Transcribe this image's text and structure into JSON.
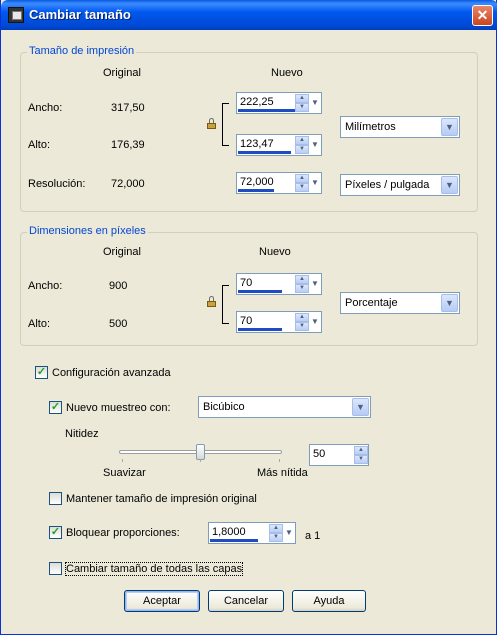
{
  "window": {
    "title": "Cambiar tamaño"
  },
  "print_size": {
    "title": "Tamaño de impresión",
    "col_original": "Original",
    "col_new": "Nuevo",
    "width_label": "Ancho:",
    "height_label": "Alto:",
    "resolution_label": "Resolución:",
    "width_original": "317,50",
    "height_original": "176,39",
    "resolution_original": "72,000",
    "width_new": "222,25",
    "height_new": "123,47",
    "resolution_new": "72,000",
    "unit": "Milímetros",
    "resolution_unit": "Píxeles / pulgada"
  },
  "pixel_dims": {
    "title": "Dimensiones en píxeles",
    "col_original": "Original",
    "col_new": "Nuevo",
    "width_label": "Ancho:",
    "height_label": "Alto:",
    "width_original": "900",
    "height_original": "500",
    "width_new": "70",
    "height_new": "70",
    "unit": "Porcentaje"
  },
  "advanced": {
    "advanced_label": "Configuración avanzada",
    "advanced_checked": true,
    "resample_label": "Nuevo muestreo con:",
    "resample_checked": true,
    "resample_method": "Bicúbico",
    "sharpness_label": "Nitidez",
    "smooth_label": "Suavizar",
    "sharper_label": "Más nítida",
    "sharpness_value": "50",
    "keep_print_label": "Mantener tamaño de impresión original",
    "keep_print_checked": false,
    "lock_ratio_label": "Bloquear proporciones:",
    "lock_ratio_checked": true,
    "ratio_value": "1,8000",
    "ratio_suffix": "a 1",
    "all_layers_label": "Cambiar tamaño de todas las capas",
    "all_layers_checked": false
  },
  "buttons": {
    "ok": "Aceptar",
    "cancel": "Cancelar",
    "help": "Ayuda"
  },
  "colors": {
    "title_bar": "#0058ee",
    "group_title": "#0046d5",
    "check_mark": "#21a121"
  }
}
